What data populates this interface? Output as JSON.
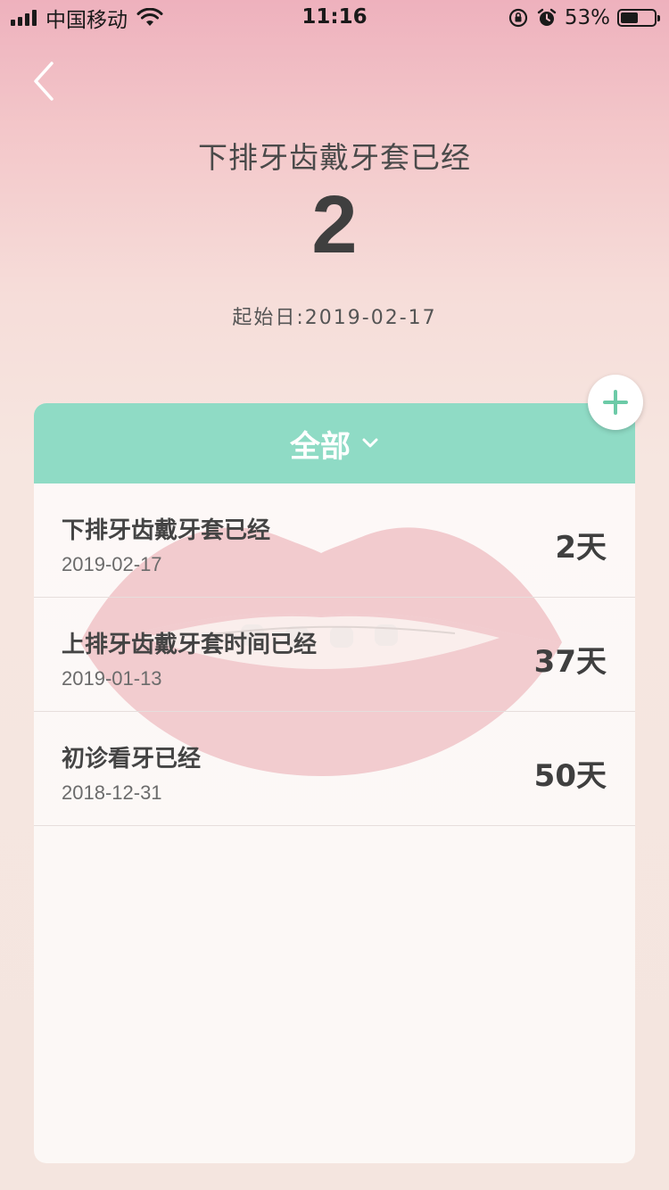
{
  "status_bar": {
    "carrier": "中国移动",
    "time": "11:16",
    "battery_percent": "53%",
    "battery_level": 0.53,
    "icons": [
      "signal-icon",
      "wifi-icon",
      "orientation-lock-icon",
      "alarm-icon",
      "battery-icon"
    ]
  },
  "header": {
    "title": "下排牙齿戴牙套已经",
    "count": "2",
    "start_date": "起始日:2019-02-17"
  },
  "filter": {
    "label": "全部",
    "icon": "chevron-down-icon"
  },
  "add_button": {
    "icon": "plus-icon"
  },
  "items": [
    {
      "title": "下排牙齿戴牙套已经",
      "date": "2019-02-17",
      "days": "2天"
    },
    {
      "title": "上排牙齿戴牙套时间已经",
      "date": "2019-01-13",
      "days": "37天"
    },
    {
      "title": "初诊看牙已经",
      "date": "2018-12-31",
      "days": "50天"
    }
  ],
  "colors": {
    "accent": "#8fdbc5",
    "plus": "#6ccaa7",
    "text_dark": "#3f3f3f"
  }
}
